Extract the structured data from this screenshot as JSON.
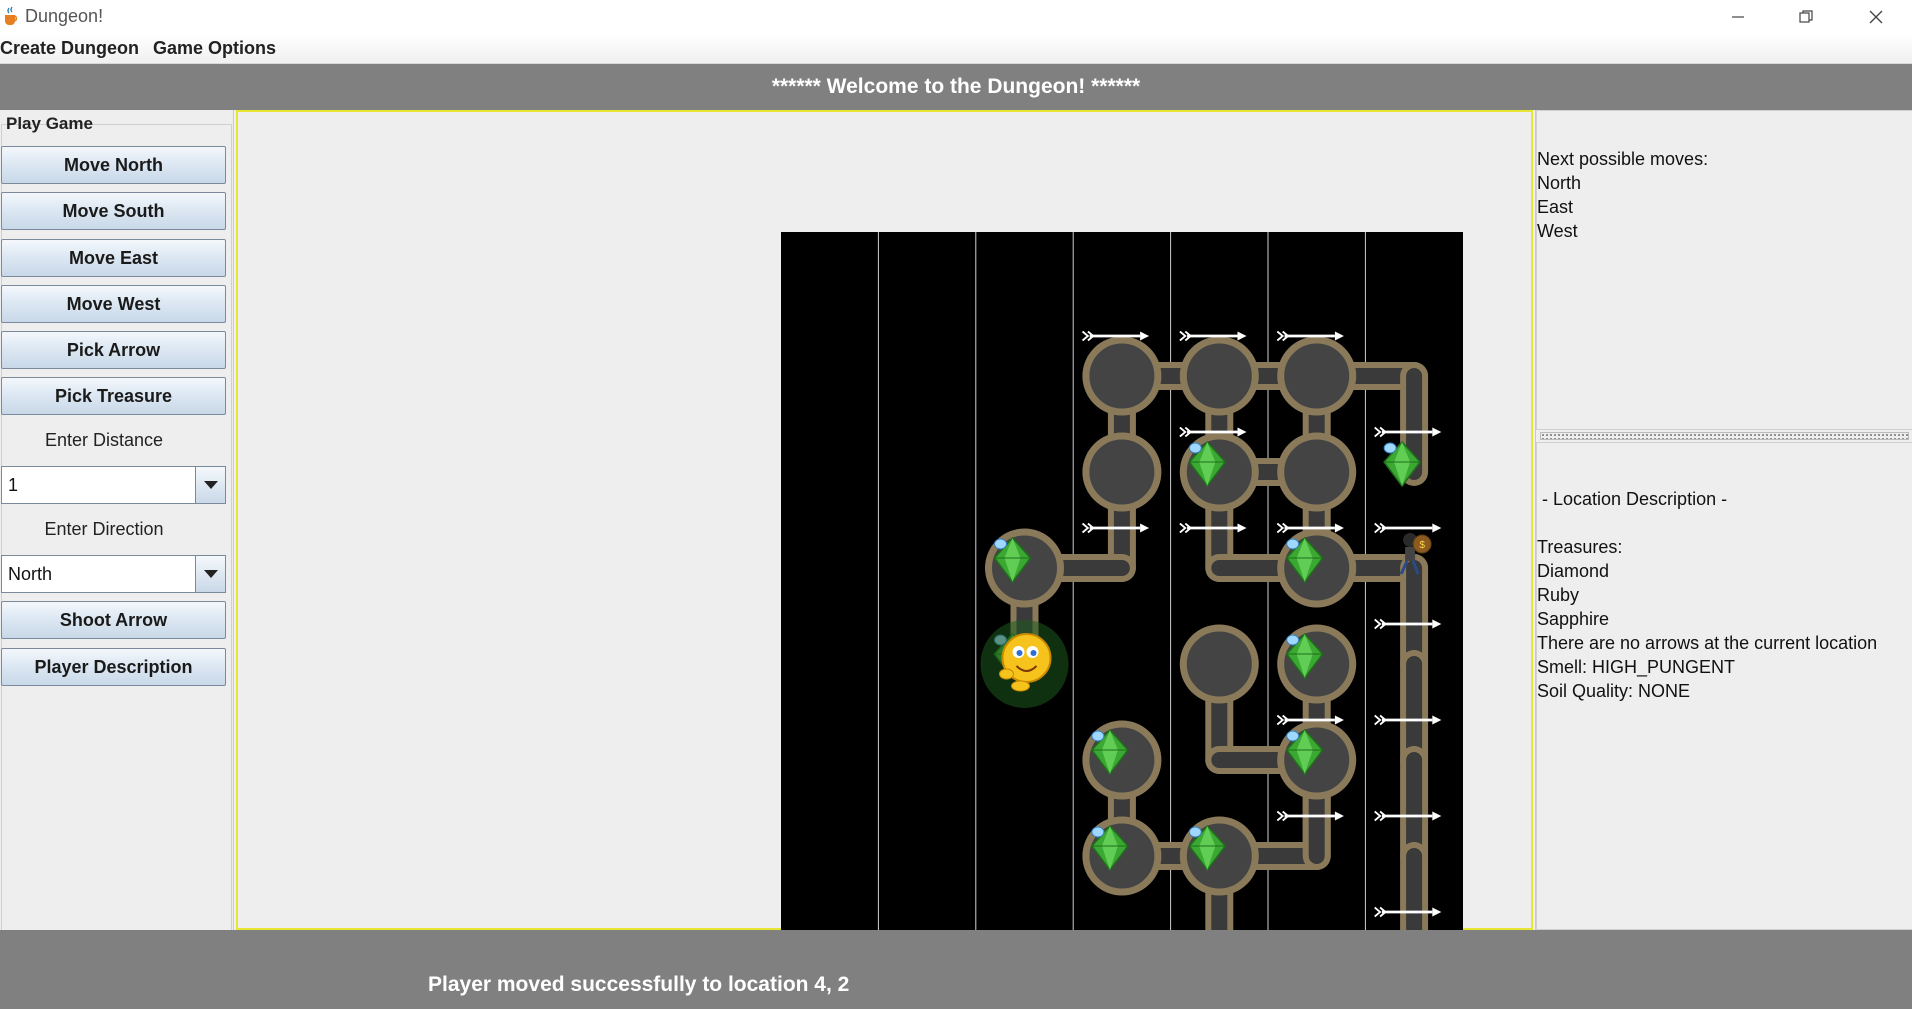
{
  "window": {
    "title": "Dungeon!"
  },
  "menu": {
    "items": [
      "Create Dungeon",
      "Game Options"
    ]
  },
  "banner": {
    "text": "****** Welcome to the Dungeon! ******"
  },
  "left_panel": {
    "group_title": "Play Game",
    "buttons": {
      "move_north": "Move North",
      "move_south": "Move South",
      "move_east": "Move East",
      "move_west": "Move West",
      "pick_arrow": "Pick Arrow",
      "pick_treasure": "Pick Treasure",
      "shoot_arrow": "Shoot Arrow",
      "player_description": "Player Description"
    },
    "distance_label": "Enter Distance",
    "distance_value": "1",
    "direction_label": "Enter Direction",
    "direction_value": "North"
  },
  "right_panel": {
    "moves_title": "Next possible moves:",
    "moves": [
      "North",
      "East",
      "West"
    ],
    "description_title": " - Location Description -",
    "treasures_label": "Treasures:",
    "treasures": [
      "Diamond",
      "Ruby",
      "Sapphire"
    ],
    "arrows_text": "There are no arrows at the current location",
    "smell": "Smell: HIGH_PUNGENT",
    "soil": "Soil Quality: NONE"
  },
  "status": {
    "message": "Player moved successfully to location 4, 2"
  },
  "colors": {
    "banner": "#808080",
    "panel_border": "#e6e633",
    "gem": "#3aa832",
    "tunnel": "#8a7a5a",
    "room": "#444444"
  },
  "dungeon": {
    "columns": 7,
    "rows": 8,
    "player": {
      "col": 2,
      "row": 4
    },
    "thief": {
      "col": 6,
      "row": 3
    }
  }
}
